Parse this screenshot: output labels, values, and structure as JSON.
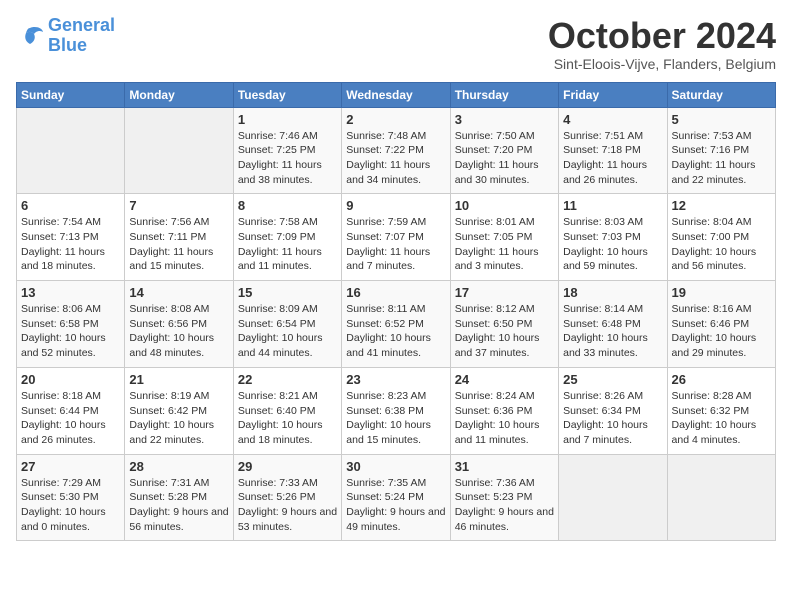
{
  "header": {
    "logo_line1": "General",
    "logo_line2": "Blue",
    "month_title": "October 2024",
    "location": "Sint-Eloois-Vijve, Flanders, Belgium"
  },
  "weekdays": [
    "Sunday",
    "Monday",
    "Tuesday",
    "Wednesday",
    "Thursday",
    "Friday",
    "Saturday"
  ],
  "weeks": [
    [
      {
        "day": "",
        "info": ""
      },
      {
        "day": "",
        "info": ""
      },
      {
        "day": "1",
        "info": "Sunrise: 7:46 AM\nSunset: 7:25 PM\nDaylight: 11 hours and 38 minutes."
      },
      {
        "day": "2",
        "info": "Sunrise: 7:48 AM\nSunset: 7:22 PM\nDaylight: 11 hours and 34 minutes."
      },
      {
        "day": "3",
        "info": "Sunrise: 7:50 AM\nSunset: 7:20 PM\nDaylight: 11 hours and 30 minutes."
      },
      {
        "day": "4",
        "info": "Sunrise: 7:51 AM\nSunset: 7:18 PM\nDaylight: 11 hours and 26 minutes."
      },
      {
        "day": "5",
        "info": "Sunrise: 7:53 AM\nSunset: 7:16 PM\nDaylight: 11 hours and 22 minutes."
      }
    ],
    [
      {
        "day": "6",
        "info": "Sunrise: 7:54 AM\nSunset: 7:13 PM\nDaylight: 11 hours and 18 minutes."
      },
      {
        "day": "7",
        "info": "Sunrise: 7:56 AM\nSunset: 7:11 PM\nDaylight: 11 hours and 15 minutes."
      },
      {
        "day": "8",
        "info": "Sunrise: 7:58 AM\nSunset: 7:09 PM\nDaylight: 11 hours and 11 minutes."
      },
      {
        "day": "9",
        "info": "Sunrise: 7:59 AM\nSunset: 7:07 PM\nDaylight: 11 hours and 7 minutes."
      },
      {
        "day": "10",
        "info": "Sunrise: 8:01 AM\nSunset: 7:05 PM\nDaylight: 11 hours and 3 minutes."
      },
      {
        "day": "11",
        "info": "Sunrise: 8:03 AM\nSunset: 7:03 PM\nDaylight: 10 hours and 59 minutes."
      },
      {
        "day": "12",
        "info": "Sunrise: 8:04 AM\nSunset: 7:00 PM\nDaylight: 10 hours and 56 minutes."
      }
    ],
    [
      {
        "day": "13",
        "info": "Sunrise: 8:06 AM\nSunset: 6:58 PM\nDaylight: 10 hours and 52 minutes."
      },
      {
        "day": "14",
        "info": "Sunrise: 8:08 AM\nSunset: 6:56 PM\nDaylight: 10 hours and 48 minutes."
      },
      {
        "day": "15",
        "info": "Sunrise: 8:09 AM\nSunset: 6:54 PM\nDaylight: 10 hours and 44 minutes."
      },
      {
        "day": "16",
        "info": "Sunrise: 8:11 AM\nSunset: 6:52 PM\nDaylight: 10 hours and 41 minutes."
      },
      {
        "day": "17",
        "info": "Sunrise: 8:12 AM\nSunset: 6:50 PM\nDaylight: 10 hours and 37 minutes."
      },
      {
        "day": "18",
        "info": "Sunrise: 8:14 AM\nSunset: 6:48 PM\nDaylight: 10 hours and 33 minutes."
      },
      {
        "day": "19",
        "info": "Sunrise: 8:16 AM\nSunset: 6:46 PM\nDaylight: 10 hours and 29 minutes."
      }
    ],
    [
      {
        "day": "20",
        "info": "Sunrise: 8:18 AM\nSunset: 6:44 PM\nDaylight: 10 hours and 26 minutes."
      },
      {
        "day": "21",
        "info": "Sunrise: 8:19 AM\nSunset: 6:42 PM\nDaylight: 10 hours and 22 minutes."
      },
      {
        "day": "22",
        "info": "Sunrise: 8:21 AM\nSunset: 6:40 PM\nDaylight: 10 hours and 18 minutes."
      },
      {
        "day": "23",
        "info": "Sunrise: 8:23 AM\nSunset: 6:38 PM\nDaylight: 10 hours and 15 minutes."
      },
      {
        "day": "24",
        "info": "Sunrise: 8:24 AM\nSunset: 6:36 PM\nDaylight: 10 hours and 11 minutes."
      },
      {
        "day": "25",
        "info": "Sunrise: 8:26 AM\nSunset: 6:34 PM\nDaylight: 10 hours and 7 minutes."
      },
      {
        "day": "26",
        "info": "Sunrise: 8:28 AM\nSunset: 6:32 PM\nDaylight: 10 hours and 4 minutes."
      }
    ],
    [
      {
        "day": "27",
        "info": "Sunrise: 7:29 AM\nSunset: 5:30 PM\nDaylight: 10 hours and 0 minutes."
      },
      {
        "day": "28",
        "info": "Sunrise: 7:31 AM\nSunset: 5:28 PM\nDaylight: 9 hours and 56 minutes."
      },
      {
        "day": "29",
        "info": "Sunrise: 7:33 AM\nSunset: 5:26 PM\nDaylight: 9 hours and 53 minutes."
      },
      {
        "day": "30",
        "info": "Sunrise: 7:35 AM\nSunset: 5:24 PM\nDaylight: 9 hours and 49 minutes."
      },
      {
        "day": "31",
        "info": "Sunrise: 7:36 AM\nSunset: 5:23 PM\nDaylight: 9 hours and 46 minutes."
      },
      {
        "day": "",
        "info": ""
      },
      {
        "day": "",
        "info": ""
      }
    ]
  ]
}
